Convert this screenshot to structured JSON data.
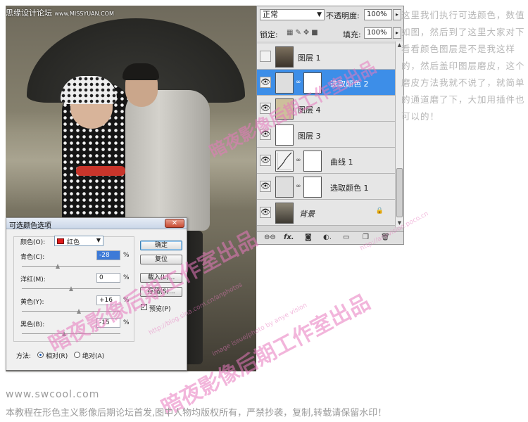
{
  "photo": {
    "forum_tag": "思缘设计论坛",
    "forum_site": "www.MISSYUAN.COM"
  },
  "dialog": {
    "title": "可选颜色选项",
    "close_icon": "close-icon",
    "color_label": "颜色(O):",
    "color_value": "红色",
    "color_swatch": "#e01b1b",
    "sliders": [
      {
        "label": "青色(C):",
        "value": "-28",
        "pct": "%",
        "level": -28
      },
      {
        "label": "洋红(M):",
        "value": "0",
        "pct": "%",
        "level": 0
      },
      {
        "label": "黄色(Y):",
        "value": "+16",
        "pct": "%",
        "level": 16
      },
      {
        "label": "黑色(B):",
        "value": "-15",
        "pct": "%",
        "level": -15
      }
    ],
    "buttons": {
      "ok": "确定",
      "reset": "复位",
      "load": "载入(L)...",
      "save": "存储(S)..."
    },
    "preview_label": "预览(P)",
    "method_label": "方法:",
    "method_relative": "相对(R)",
    "method_absolute": "绝对(A)"
  },
  "layers_panel": {
    "blend_mode": "正常",
    "opacity_label": "不透明度:",
    "opacity_value": "100%",
    "lock_label": "锁定:",
    "fill_label": "填充:",
    "fill_value": "100%",
    "layers": [
      {
        "name": "图层 1",
        "visible": false,
        "selected": false,
        "has_mask": false,
        "thumb": "photo"
      },
      {
        "name": "选取颜色 2",
        "visible": true,
        "selected": true,
        "has_mask": true,
        "thumb": "adjust"
      },
      {
        "name": "图层 4",
        "visible": true,
        "selected": false,
        "has_mask": false,
        "thumb": "beige"
      },
      {
        "name": "图层 3",
        "visible": true,
        "selected": false,
        "has_mask": false,
        "thumb": "white"
      },
      {
        "name": "曲线 1",
        "visible": true,
        "selected": false,
        "has_mask": true,
        "thumb": "curves"
      },
      {
        "name": "选取颜色 1",
        "visible": true,
        "selected": false,
        "has_mask": true,
        "thumb": "adjust"
      },
      {
        "name": "背景",
        "visible": true,
        "selected": false,
        "has_mask": false,
        "thumb": "photo",
        "locked": true
      }
    ],
    "footer_icons": [
      "link-icon",
      "fx-icon",
      "mask-icon",
      "adjustment-icon",
      "folder-icon",
      "new-layer-icon",
      "trash-icon"
    ],
    "footer_fx": "fx."
  },
  "caption": "这里我们执行可选颜色，数值如图，然后到了这里大家对下看看颜色图层是不是我这样的，然后盖印图层磨皮，这个磨皮方法我就不说了，就简单的通道磨了下，大加用插件也可以的！",
  "watermarks": {
    "studio": "暗夜影像后期工作室出品",
    "blog": "http://blog.sina.com.cn/anphotos",
    "poco": "http://anyvision.poco.cn",
    "byline": "image issue/photo by anye vision"
  },
  "footer": {
    "site": "www.swcool.com",
    "notice": "本教程在形色主义影像后期论坛首发,图中人物均版权所有，严禁抄袭，复制,转载请保留水印！"
  }
}
